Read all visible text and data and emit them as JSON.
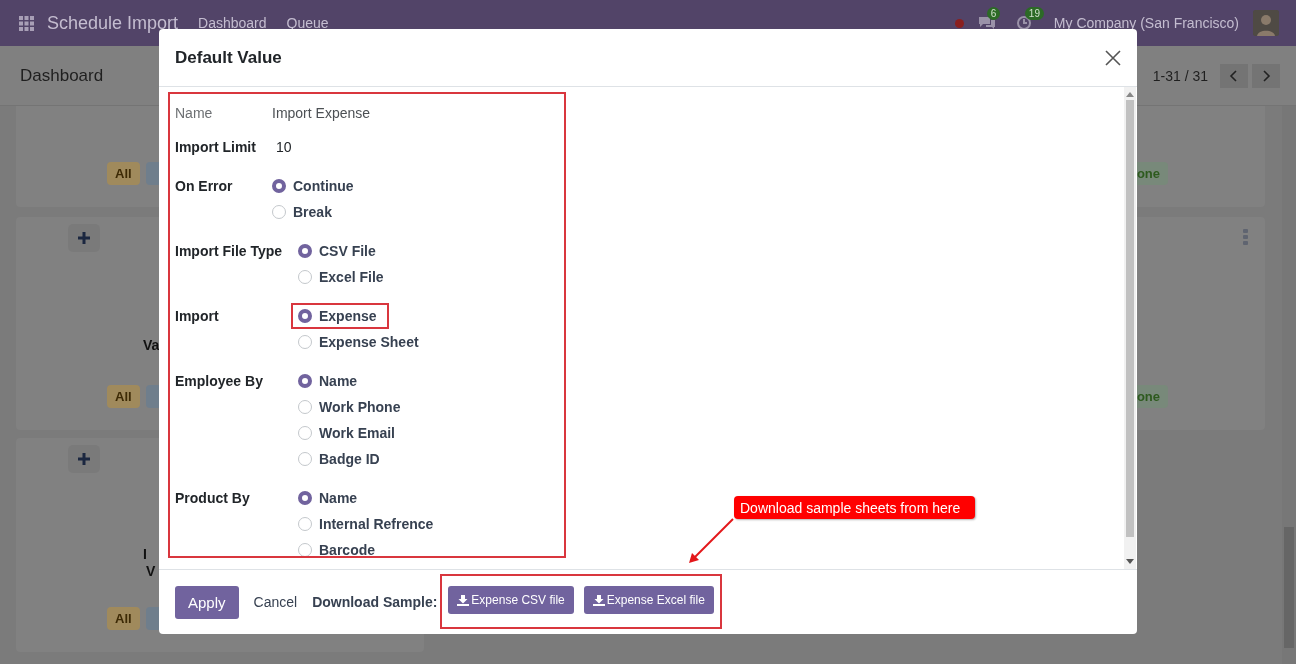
{
  "navbar": {
    "app_title": "Schedule Import",
    "menu": [
      {
        "label": "Dashboard"
      },
      {
        "label": "Queue"
      }
    ],
    "messages_badge": "6",
    "activities_badge": "19",
    "company": "My Company (San Francisco)"
  },
  "control_panel": {
    "breadcrumb": "Dashboard",
    "pager": "1-31 / 31"
  },
  "left_cards": [
    {
      "has_add": false,
      "tag": "All"
    },
    {
      "has_add": true,
      "title_lines": [
        "Va"
      ],
      "tag": "All"
    },
    {
      "has_add": true,
      "title_lines": [
        "I",
        "V"
      ],
      "tag": "All"
    }
  ],
  "right_cards": [
    {
      "menu": false,
      "tag": "one"
    },
    {
      "menu": true,
      "tag": "one"
    }
  ],
  "dialog": {
    "title": "Default Value",
    "groups": [
      {
        "fields": [
          {
            "label": "Name",
            "kind": "text",
            "value": "Import Expense",
            "readonly": true
          },
          {
            "label": "Import Limit",
            "kind": "text",
            "value": "10",
            "readonly": false
          },
          {
            "label": "On Error",
            "kind": "radio",
            "readonly": false,
            "options": [
              {
                "label": "Continue",
                "selected": true,
                "highlighted": false
              },
              {
                "label": "Break",
                "selected": false,
                "highlighted": false
              }
            ]
          }
        ]
      },
      {
        "fields": [
          {
            "label": "Import File Type",
            "kind": "radio",
            "readonly": false,
            "options": [
              {
                "label": "CSV File",
                "selected": true,
                "highlighted": false
              },
              {
                "label": "Excel File",
                "selected": false,
                "highlighted": false
              }
            ]
          },
          {
            "label": "Import",
            "kind": "radio",
            "readonly": false,
            "options": [
              {
                "label": "Expense",
                "selected": true,
                "highlighted": true
              },
              {
                "label": "Expense Sheet",
                "selected": false,
                "highlighted": false
              }
            ]
          },
          {
            "label": "Employee By",
            "kind": "radio",
            "readonly": false,
            "options": [
              {
                "label": "Name",
                "selected": true,
                "highlighted": false
              },
              {
                "label": "Work Phone",
                "selected": false,
                "highlighted": false
              },
              {
                "label": "Work Email",
                "selected": false,
                "highlighted": false
              },
              {
                "label": "Badge ID",
                "selected": false,
                "highlighted": false
              }
            ]
          },
          {
            "label": "Product By",
            "kind": "radio",
            "readonly": false,
            "options": [
              {
                "label": "Name",
                "selected": true,
                "highlighted": false
              },
              {
                "label": "Internal Refrence",
                "selected": false,
                "highlighted": false
              },
              {
                "label": "Barcode",
                "selected": false,
                "highlighted": false
              }
            ]
          }
        ]
      }
    ],
    "footer": {
      "apply": "Apply",
      "cancel": "Cancel",
      "download_label": "Download Sample:",
      "downloads": [
        "Expense CSV file",
        "Expense Excel file"
      ]
    }
  },
  "annotation": {
    "text": "Download sample sheets from here"
  }
}
